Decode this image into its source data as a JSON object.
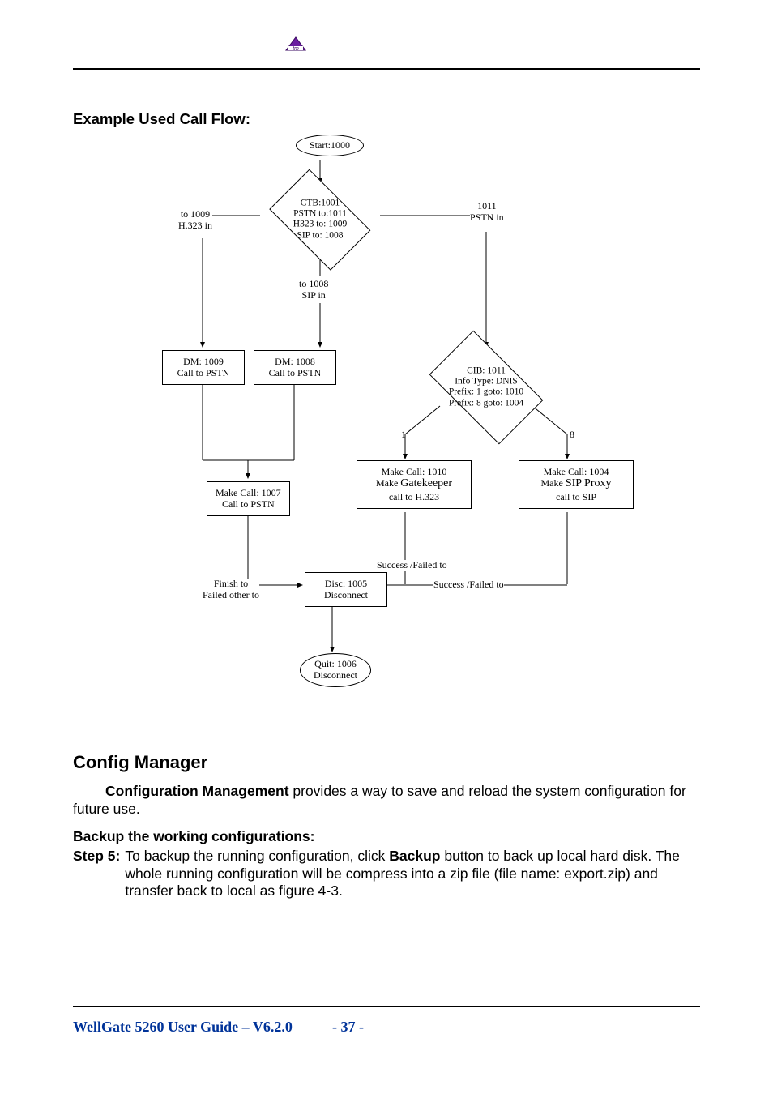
{
  "section_title": "Example Used Call Flow:",
  "flow": {
    "start": "Start:1000",
    "ctb": "CTB:1001\nPSTN to:1011\nH323 to: 1009\nSIP to: 1008",
    "label_1009": "to 1009\nH.323 in",
    "label_1011": "1011\nPSTN in",
    "label_1008": "to 1008\nSIP in",
    "dm1009": "DM: 1009\nCall to PSTN",
    "dm1008": "DM: 1008\nCall to PSTN",
    "cib": "CIB: 1011\nInfo Type: DNIS\nPrefix: 1 goto: 1010\nPrefix: 8 goto: 1004",
    "branch1": "1",
    "branch8": "8",
    "mc1007": "Make Call: 1007\nCall to PSTN",
    "mc1010_title": "Make Call: 1010",
    "mc1010_l2a": "Make ",
    "mc1010_l2b": "Gatekeeper",
    "mc1010_l3": "call to H.323",
    "mc1004_title": "Make Call: 1004",
    "mc1004_l2a": "Make ",
    "mc1004_l2b": "SIP Proxy",
    "mc1004_l3": "call to SIP",
    "sf_up": "Success /Failed to",
    "sf_right": "Success /Failed to",
    "finish": "Finish to\nFailed other to",
    "disc": "Disc: 1005\nDisconnect",
    "quit": "Quit: 1006\nDisconnect"
  },
  "config_manager_heading": "Config Manager",
  "cm_para_b": "Configuration Management",
  "cm_para_rest": " provides a way to save and reload the system configuration for future use.",
  "backup_heading": "Backup the working configurations:",
  "step5_label": "Step 5:",
  "step5_before_backup": " To backup the running configuration, click ",
  "step5_backup": "Backup",
  "step5_after_backup": " button to back up local hard disk. The whole running configuration will be compress into a zip file (file name: export.zip) and transfer back to local as figure 4-3.",
  "footer_left": "WellGate 5260 User Guide – V6.2.0",
  "footer_page": "- 37 -"
}
